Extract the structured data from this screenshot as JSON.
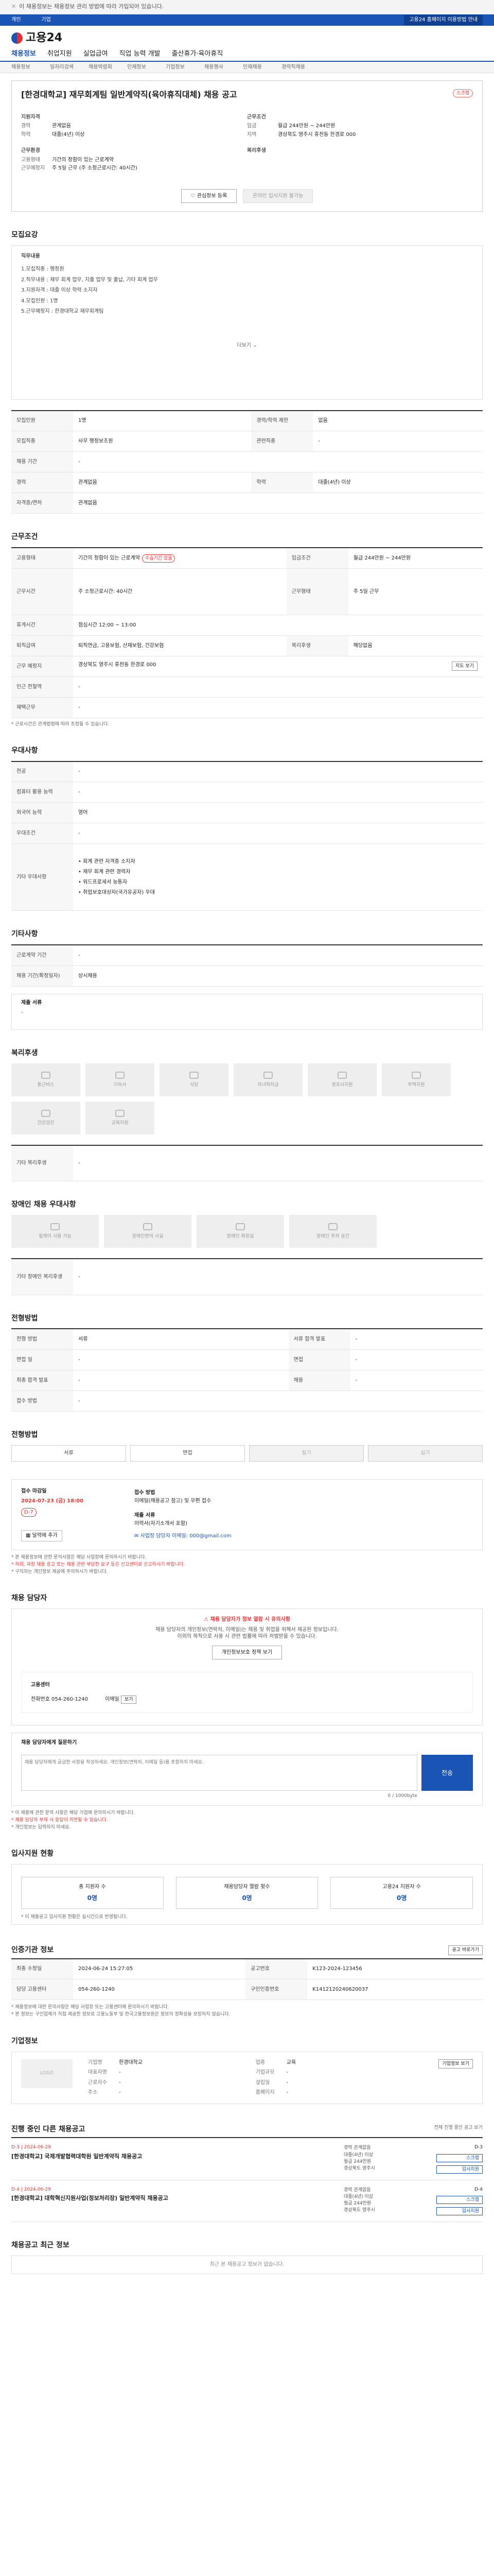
{
  "notice": "이 채용정보는 채용정보 관리 방법에 따라 가입되어 있습니다.",
  "util": {
    "left": [
      "개인",
      "기업"
    ],
    "right": "고용24 홈페이지 이용방법 안내"
  },
  "logo": "고용24",
  "gnb": [
    "채용정보",
    "취업지원",
    "실업급여",
    "직업 능력 개발",
    "출산휴가·육아휴직"
  ],
  "subnav": [
    "채용정보",
    "일자리검색",
    "채용박람회",
    "인재정보",
    "기업정보",
    "채용행사",
    "인재채용",
    "경력직채용"
  ],
  "title": "[한경대학교] 재무회계팀 일반계약직(육아휴직대체) 채용 공고",
  "scrap": "스크랩",
  "summary": {
    "left_heading": "지원자격",
    "left": [
      [
        "경력",
        "관계없음"
      ],
      [
        "학력",
        "대졸(4년) 이상"
      ]
    ],
    "left_heading2": "근무환경",
    "left2": [
      [
        "고용형태",
        "기간의 정함이 있는 근로계약"
      ],
      [
        "근무예정지",
        "주 5일 근무 (주 소정근로시간: 40시간)"
      ]
    ],
    "right_heading": "근무조건",
    "right": [
      [
        "임금",
        "월급 244만원 ~ 244만원"
      ],
      [
        "지역",
        "경상북도 영주시 휴천동 한경로 000"
      ]
    ],
    "right_heading2": "복리후생"
  },
  "buttons": {
    "interest": "관심정보 등록",
    "apply": "온라인 입사지원 불가능"
  },
  "job": {
    "heading": "모집요강",
    "sub": "직무내용",
    "lines": [
      "1.모집직종 : 행정원",
      "2.직무내용 : 재무 회계 업무, 지출 업무 및 출납, 기타 회계 업무",
      "3.지원자격 : 대졸 이상 학력 소지자",
      "4.모집인원 : 1명",
      "5.근무예정지 : 한경대학교 재무회계팀"
    ],
    "more": "더보기"
  },
  "recruit": {
    "rows": [
      [
        "모집인원",
        "1명",
        "경력/학력 제한",
        "없음"
      ],
      [
        "모집직종",
        "사무 행정보조원",
        "관련직종",
        "-"
      ],
      [
        "채용 기간",
        "-",
        "",
        ""
      ],
      [
        "경력",
        "관계없음",
        "학력",
        "대졸(4년) 이상"
      ],
      [
        "자격증/면허",
        "관계없음",
        "",
        ""
      ]
    ]
  },
  "cond": {
    "heading": "근무조건",
    "rows": [
      [
        "고용형태",
        "기간의 정함이 있는 근로계약",
        "임금조건",
        "월급 244만원 ~ 244만원"
      ],
      [
        "근무시간",
        "주 소정근로시간: 40시간",
        "근무형태",
        "주 5일 근무"
      ],
      [
        "휴게시간",
        "점심시간 12:00 ~ 13:00",
        "",
        ""
      ],
      [
        "퇴직급여",
        "퇴직연금, 고용보험, 산재보험, 건강보험",
        "복리후생",
        "해당없음"
      ],
      [
        "근무 예정지",
        "경상북도 영주시 휴천동 한경로 000",
        "",
        ""
      ],
      [
        "인근 전철역",
        "-",
        "",
        ""
      ],
      [
        "재택근무",
        "-",
        "",
        ""
      ]
    ],
    "note": "* 근로시간은 관계법령에 따라 조정될 수 있습니다.",
    "tag": "수습기간 있음",
    "map": "지도 보기"
  },
  "apply": {
    "heading": "우대사항",
    "rows": [
      [
        "전공",
        "-"
      ],
      [
        "컴퓨터 활용 능력",
        "-"
      ],
      [
        "외국어 능력",
        "영어"
      ],
      [
        "우대조건",
        "-"
      ],
      [
        "기타 우대사항",
        "• 회계 관련 자격증 소지자\n• 재무 회계 관련 경력자\n• 워드프로세서 능통자\n• 취업보호대상자(국가유공자) 우대"
      ]
    ]
  },
  "etc": {
    "heading": "기타사항",
    "rows": [
      [
        "근로계약 기간",
        "-"
      ],
      [
        "채용 기간(확정일자)",
        "상시채용"
      ]
    ],
    "docs_title": "제출 서류",
    "docs": "-"
  },
  "benefit": {
    "heading": "복리후생",
    "items": [
      "통근버스",
      "기숙사",
      "식당",
      "자녀학자금",
      "경조사지원",
      "주택지원",
      "건강검진",
      "교육지원"
    ],
    "extra_k": "기타 복리후생",
    "extra_v": "-"
  },
  "disabled": {
    "heading": "장애인 채용 우대사항",
    "items": [
      "휠체어 사용 가능",
      "장애인편의 시설",
      "장애인 화장실",
      "장애인 주차 공간"
    ],
    "extra_k": "기타 장애인 복리후생",
    "extra_v": "-"
  },
  "select": {
    "heading": "전형방법",
    "rows": [
      [
        "전형 방법",
        "서류",
        "서류 합격 발표",
        "-"
      ],
      [
        "면접 일",
        "-",
        "면접",
        "-"
      ],
      [
        "최종 합격 발표",
        "-",
        "채용",
        "-"
      ],
      [
        "접수 방법",
        "-",
        "",
        ""
      ]
    ]
  },
  "proc": {
    "heading": "전형방법",
    "btns": [
      "서류",
      "면접",
      "필기",
      "실기"
    ],
    "deadline_k": "접수 마감일",
    "deadline": "2024-07-23 (금) 18:00",
    "dday": "D-7",
    "cal": "달력에 추가",
    "method_k": "접수 방법",
    "method": "이메일(채용공고 참고) 및 우편 접수",
    "docs_k": "제출 서류",
    "docs": "이력서(자기소개서 포함)",
    "email": "사업장 담당자 이메일: 000@gmail.com",
    "notes": [
      "* 본 채용정보에 관한 문의사항은 해당 사업장에 문의하시기 바랍니다.",
      "* 허위, 과장 채용 광고 또는 채용 관련 부당한 요구 등은 신고센터로 신고하시기 바랍니다.",
      "* 구직자는 개인정보 제공에 주의하시기 바랍니다."
    ]
  },
  "mgr": {
    "heading": "채용 담당자",
    "warn": "채용 담당자가 정보 열람 시 유의사항",
    "sub": "채용 담당자의 개인정보(연락처, 이메일)는 채용 및 취업을 위해서 제공된 정보입니다.",
    "sub2": "이외의 목적으로 사용 시 관련 법률에 따라 처벌받을 수 있습니다.",
    "view_btn": "개인정보보호 정책 보기",
    "k1": "고용센터",
    "k2": "전화번호",
    "v2": "054-260-1240",
    "k3": "이메일",
    "v3": "보기",
    "q_title": "채용 담당자에게 질문하기",
    "q_placeholder": "채용 담당자에게 궁금한 사항을 작성하세요. 개인정보(연락처, 이메일 등)를 포함하지 마세요.",
    "q_count": "0 / 1000byte",
    "send": "전송",
    "notes": [
      "* 이 채용에 관한 문의 사항은 해당 기업에 문의하시기 바랍니다.",
      "* 채용 담당자 부재 시 응답이 지연될 수 있습니다.",
      "* 개인정보는 입력하지 마세요."
    ]
  },
  "stats": {
    "heading": "입사지원 현황",
    "items": [
      [
        "총 지원자 수",
        "0명"
      ],
      [
        "채용담당자 열람 횟수",
        "0명"
      ],
      [
        "고용24 지원자 수",
        "0명"
      ]
    ],
    "note": "* 이 채용공고 입사지원 현황은 실시간으로 반영됩니다."
  },
  "reginfo": {
    "heading": "인증기관 정보",
    "btn": "공고 바로가기",
    "rows": [
      [
        "최종 수정일",
        "2024-06-24 15:27:05",
        "공고번호",
        "K123-2024-123456"
      ],
      [
        "담당 고용센터",
        "054-260-1240",
        "구인인증번호",
        "K1412120240620037"
      ]
    ],
    "notes": [
      "* 채용정보에 대한 문의사항은 해당 사업장 또는 고용센터에 문의하시기 바랍니다.",
      "* 본 정보는 구인업체가 직접 제공한 정보로 고용노동부 및 한국고용정보원은 정보의 정확성을 보장하지 않습니다."
    ]
  },
  "company": {
    "heading": "기업정보",
    "logo": "LOGO",
    "info": [
      [
        "기업명",
        "한경대학교",
        "업종",
        "교육"
      ],
      [
        "대표자명",
        "-",
        "기업규모",
        "-"
      ],
      [
        "근로자수",
        "-",
        "설립일",
        "-"
      ],
      [
        "주소",
        "-",
        "홈페이지",
        "-"
      ]
    ],
    "btn": "기업정보 보기"
  },
  "related": {
    "heading": "진행 중인 다른 채용공고",
    "sub": "전체 진행 중인 공고 보기",
    "items": [
      {
        "date": "D-3 | 2024-06-29",
        "title": "[한경대학교] 국제개발협력대학원 일반계약직 채용공고",
        "conds": [
          "경력 관계없음",
          "대졸(4년) 이상",
          "월급 244만원",
          "경상북도 영주시"
        ],
        "side": "D-3",
        "btn1": "스크랩",
        "btn2": "입사지원"
      },
      {
        "date": "D-4 | 2024-06-29",
        "title": "[한경대학교] 대학혁신지원사업(정보처리장) 일반계약직 채용공고",
        "conds": [
          "경력 관계없음",
          "대졸(4년) 이상",
          "월급 244만원",
          "경상북도 영주시"
        ],
        "side": "D-4",
        "btn1": "스크랩",
        "btn2": "입사지원"
      }
    ]
  },
  "nearby": {
    "heading": "채용공고 최근 정보",
    "empty": "최근 본 채용공고 정보가 없습니다."
  }
}
